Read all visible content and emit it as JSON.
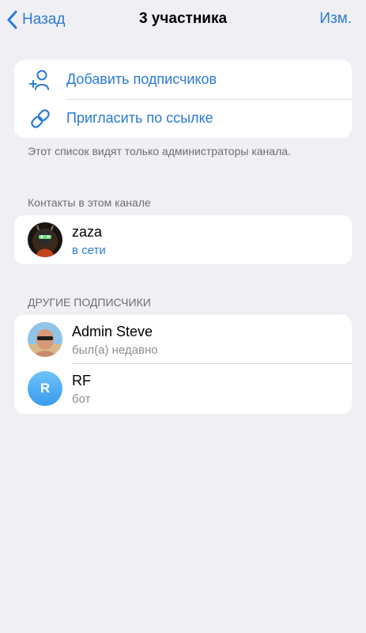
{
  "nav": {
    "back_label": "Назад",
    "title": "3 участника",
    "edit_label": "Изм."
  },
  "actions": [
    {
      "label": "Добавить подписчиков",
      "icon": "add-person-icon"
    },
    {
      "label": "Пригласить по ссылке",
      "icon": "link-icon"
    }
  ],
  "admin_note": "Этот список видят только администраторы канала.",
  "contacts_section": {
    "title": "Контакты в этом канале",
    "members": [
      {
        "name": "zaza",
        "status": "в сети"
      }
    ]
  },
  "others_section": {
    "title": "ДРУГИЕ ПОДПИСЧИКИ",
    "members": [
      {
        "name": "Admin Steve",
        "status": "был(а) недавно"
      },
      {
        "name": "RF",
        "status": "бот",
        "initial": "R"
      }
    ]
  },
  "colors": {
    "accent": "#2a7ad6",
    "background": "#efeff4",
    "secondary_text": "#8e8e93"
  }
}
